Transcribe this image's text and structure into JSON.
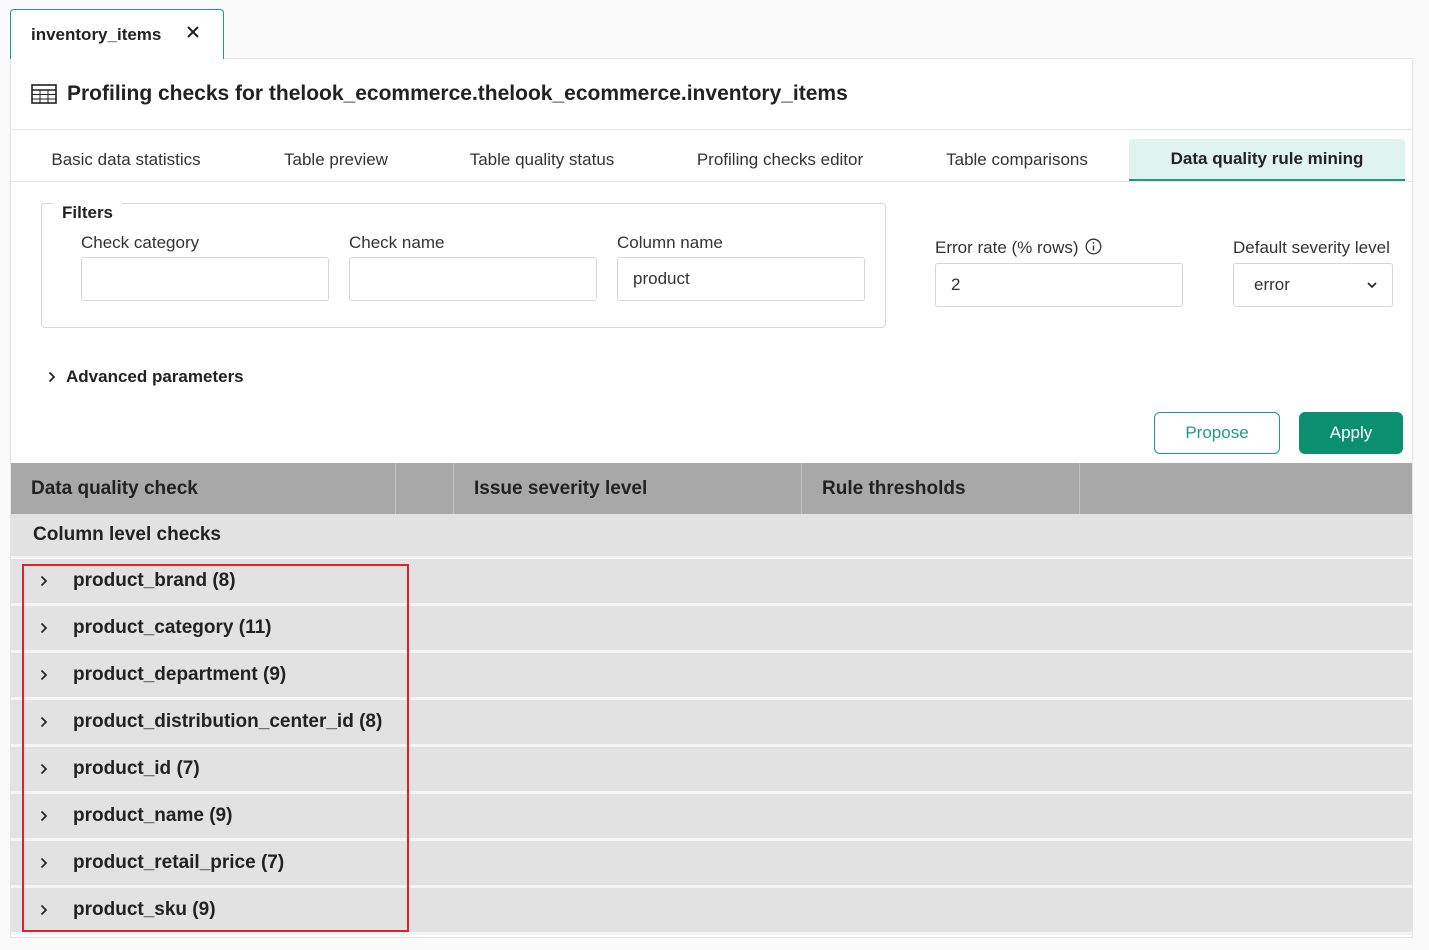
{
  "doc_tab": {
    "label": "inventory_items"
  },
  "header": {
    "title": "Profiling checks for thelook_ecommerce.thelook_ecommerce.inventory_items"
  },
  "tabs": [
    {
      "label": "Basic data statistics",
      "active": false
    },
    {
      "label": "Table preview",
      "active": false
    },
    {
      "label": "Table quality status",
      "active": false
    },
    {
      "label": "Profiling checks editor",
      "active": false
    },
    {
      "label": "Table comparisons",
      "active": false
    },
    {
      "label": "Data quality rule mining",
      "active": true
    }
  ],
  "filters": {
    "legend": "Filters",
    "check_category": {
      "label": "Check category",
      "value": ""
    },
    "check_name": {
      "label": "Check name",
      "value": ""
    },
    "column_name": {
      "label": "Column name",
      "value": "product"
    }
  },
  "error_rate": {
    "label": "Error rate (% rows)",
    "value": "2"
  },
  "default_severity": {
    "label": "Default severity level",
    "value": "error"
  },
  "advanced": {
    "label": "Advanced parameters"
  },
  "buttons": {
    "propose": "Propose",
    "apply": "Apply"
  },
  "table": {
    "headers": [
      "Data quality check",
      "Issue severity level",
      "Rule thresholds"
    ],
    "group_label": "Column level checks",
    "rows": [
      "product_brand (8)",
      "product_category (11)",
      "product_department (9)",
      "product_distribution_center_id (8)",
      "product_id (7)",
      "product_name (9)",
      "product_retail_price (7)",
      "product_sku (9)"
    ]
  },
  "colors": {
    "accent": "#1d9b84",
    "apply_bg": "#0a8f6f",
    "highlight": "#e0202b"
  }
}
